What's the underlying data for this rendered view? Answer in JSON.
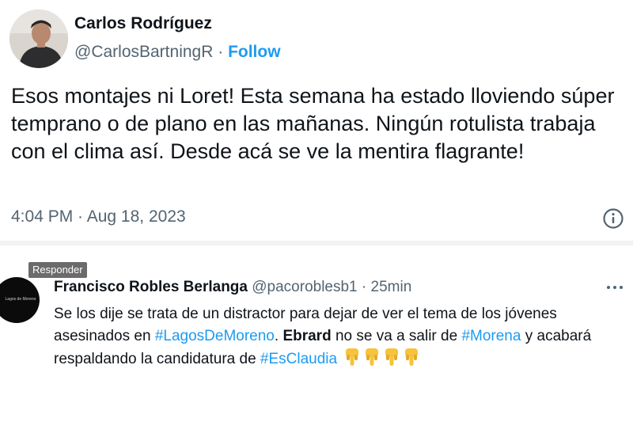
{
  "tweet": {
    "author_name": "Carlos Rodríguez",
    "handle": "@CarlosBartningR",
    "separator": " · ",
    "follow_label": "Follow",
    "text": "Esos montajes ni Loret! Esta semana ha estado lloviendo súper temprano o de plano en las mañanas. Ningún rotulista trabaja con el clima así. Desde acá se ve la mentira flagrante!",
    "time": "4:04 PM",
    "date": "Aug 18, 2023",
    "meta_separator": " · ",
    "info_icon": "info-icon"
  },
  "reply": {
    "tooltip": "Responder",
    "avatar_text": "Lagos de Moreno",
    "author_name": "Francisco Robles Berlanga",
    "handle": "@pacoroblesb1",
    "separator": " · ",
    "time_ago": "25min",
    "more_icon": "more-dots-icon",
    "text_1": "Se los dije se trata de un distractor para dejar de ver el tema de los jóvenes asesinados en ",
    "hashtag_1": "#LagosDeMoreno",
    "text_2": ". ",
    "bold_1": "Ebrard",
    "text_3": " no se va a salir de ",
    "hashtag_2": "#Morena",
    "text_4": " y acabará respaldando la candidatura de ",
    "hashtag_3": "#EsClaudia",
    "emoji_icon": "pointing-down-hand-icon",
    "emoji_count": 4
  },
  "colors": {
    "link": "#1d9bf0",
    "text": "#0f1419",
    "secondary": "#536471",
    "tooltip_bg": "#6b6b6b",
    "emoji": "#f6c33b"
  }
}
